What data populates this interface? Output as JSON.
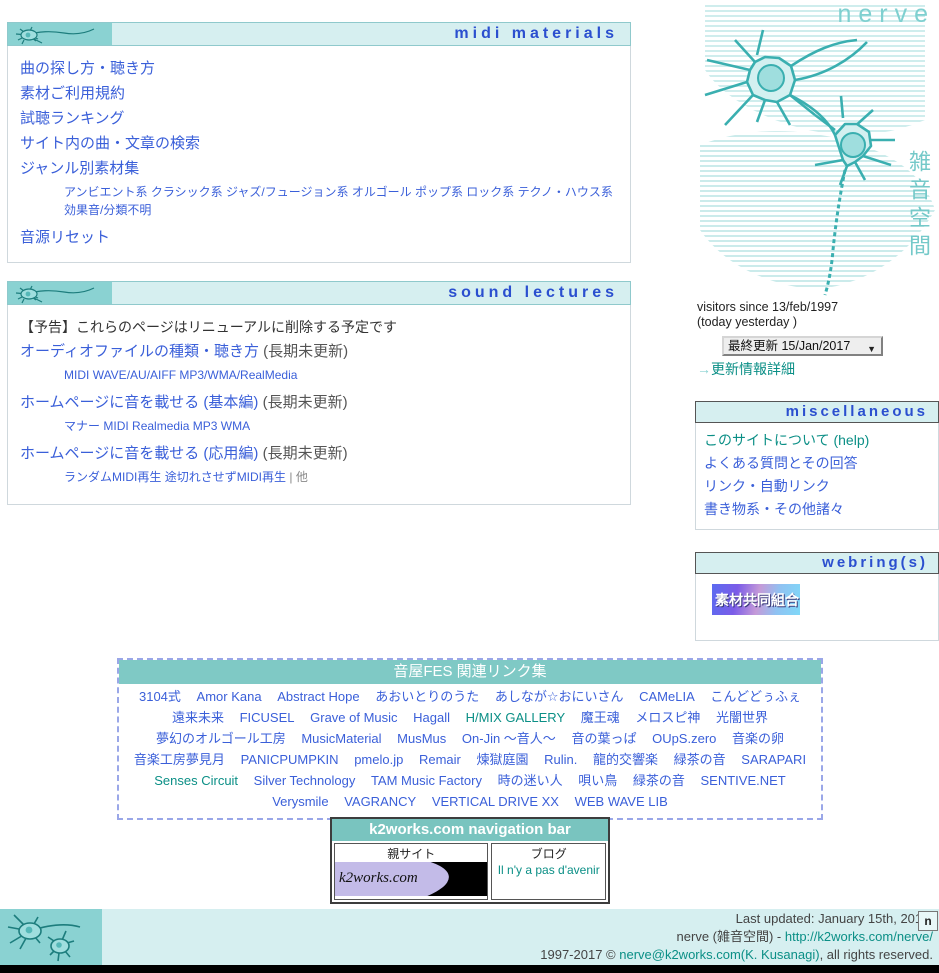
{
  "site": {
    "wordmark": "nerve",
    "vertical_jp": "雑音空間"
  },
  "panels": [
    {
      "id": "midi-materials",
      "title": "midi materials",
      "links": [
        "曲の探し方・聴き方",
        "素材ご利用規約",
        "試聴ランキング",
        "サイト内の曲・文章の検索",
        "ジャンル別素材集"
      ],
      "genres": [
        "アンビエント系",
        "クラシック系",
        "ジャズ/フュージョン系",
        "オルゴール",
        "ポップ系",
        "ロック系",
        "テクノ・ハウス系",
        "効果音/分類不明"
      ],
      "tail_link": "音源リセット"
    },
    {
      "id": "sound-lectures",
      "title": "sound lectures",
      "notice": "【予告】これらのページはリニューアルに削除する予定です",
      "entries": [
        {
          "link": "オーディオファイルの種類・聴き方",
          "note": "(長期未更新)",
          "sub": [
            "MIDI",
            "WAVE/AU/AIFF",
            "MP3/WMA/RealMedia"
          ]
        },
        {
          "link": "ホームページに音を載せる (基本編)",
          "note": "(長期未更新)",
          "sub": [
            "マナー",
            "MIDI",
            "Realmedia",
            "MP3",
            "WMA"
          ]
        },
        {
          "link": "ホームページに音を載せる (応用編)",
          "note": "(長期未更新)",
          "sub": [
            "ランダムMIDI再生",
            "途切れさせずMIDI再生"
          ],
          "sub_tail": "| 他"
        }
      ]
    }
  ],
  "sidebar": {
    "visitors_line1": "visitors since 13/feb/1997",
    "visitors_line2": "(today yesterday )",
    "update_select": {
      "label": "最終更新",
      "value": "最終更新  15/Jan/2017",
      "date": "15/Jan/2017",
      "options": [
        "最終更新  15/Jan/2017"
      ]
    },
    "update_detail_link": "更新情報詳細",
    "update_detail_arrow": "→",
    "miscellaneous": {
      "title": "miscellaneous",
      "items": [
        "このサイトについて (help)",
        "よくある質問とその回答",
        "リンク・自動リンク",
        "書き物系・その他諸々"
      ]
    },
    "webrings": {
      "title": "webring(s)",
      "banner_label": "素材共同組合"
    }
  },
  "fes": {
    "title": "音屋FES 関連リンク集",
    "links": [
      "3104式",
      "Amor Kana",
      "Abstract Hope",
      "あおいとりのうた",
      "あしなが☆おにいさん",
      "CAMeLIA",
      "こんどどぅふぇ",
      "遠来未来",
      "FICUSEL",
      "Grave of Music",
      "Hagall",
      "H/MIX GALLERY",
      "魔王魂",
      "メロスピ神",
      "光闇世界",
      "夢幻のオルゴール工房",
      "MusicMaterial",
      "MusMus",
      "On-Jin ～音人～",
      "音の葉っぱ",
      "OUpS.zero",
      "音楽の卵",
      "音楽工房夢見月",
      "PANICPUMPKIN",
      "pmelo.jp",
      "Remair",
      "煉獄庭園",
      "Rulin.",
      "龍的交響楽",
      "緑茶の音",
      "SARAPARI",
      "Senses Circuit",
      "Silver Technology",
      "TAM Music Factory",
      "時の迷い人",
      "唄い鳥",
      "緑茶の音",
      "SENTIVE.NET",
      "Verysmile",
      "VAGRANCY",
      "VERTICAL DRIVE XX",
      "WEB WAVE LIB"
    ],
    "teal_links": [
      "H/MIX GALLERY",
      "Senses Circuit"
    ]
  },
  "k2nav": {
    "title": "k2works.com navigation bar",
    "parent_caption": "親サイト",
    "parent_name": "k2works.com",
    "blog_caption": "ブログ",
    "blog_name": "Il n'y a pas d'avenir"
  },
  "footer": {
    "last_updated": "Last updated: January 15th, 2017.",
    "n_badge": "n",
    "site_line_prefix": "nerve (雑音空間) - ",
    "site_url": "http://k2works.com/nerve/",
    "copyright_prefix": "1997-2017 © ",
    "copyright_email": "nerve@k2works.com(K. Kusanagi)",
    "copyright_suffix": ", all rights reserved."
  },
  "colors": {
    "accent_teal": "#8ad2d2",
    "panel_head_bg": "#d6eff0",
    "link_blue": "#3a5fd9",
    "link_teal": "#0b8f86",
    "fes_head_bg": "#7fc9c5"
  }
}
